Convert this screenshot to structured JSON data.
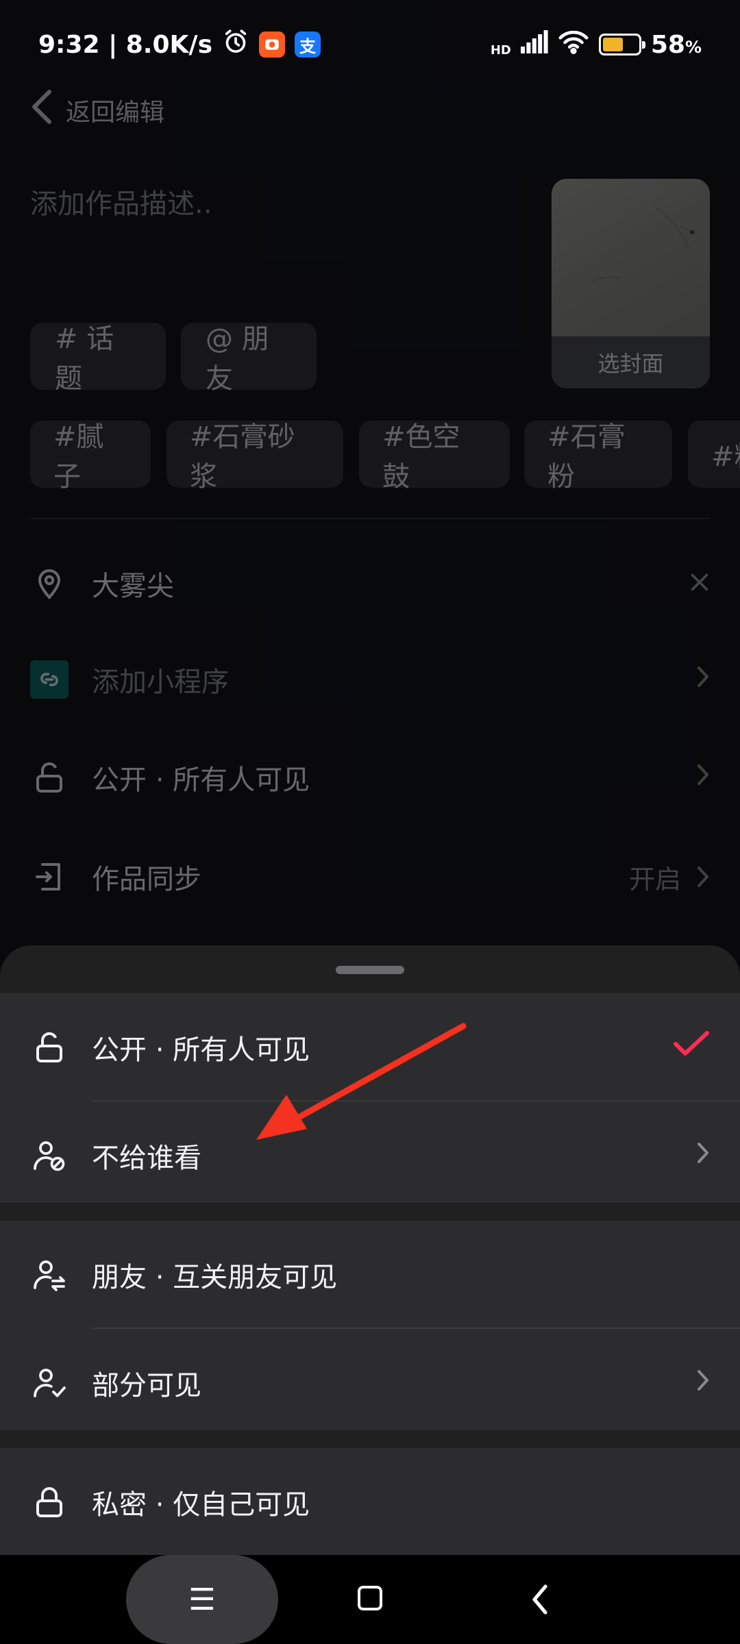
{
  "status_bar": {
    "time_speed": "9:32 | 8.0K/s",
    "network": "HD",
    "battery_percent": "58",
    "battery_unit": "%",
    "battery_level": 0.58,
    "apps": [
      {
        "name": "taobao-app-icon",
        "color": "#ff5a1f"
      },
      {
        "name": "alipay-app-icon",
        "label": "支",
        "color": "#1677ff"
      }
    ]
  },
  "header": {
    "back_label": "返回编辑"
  },
  "editor": {
    "description_placeholder": "添加作品描述..",
    "cover_label": "选封面",
    "topic_chip": "# 话题",
    "friend_chip": "@ 朋友",
    "hashtags": [
      "#腻子",
      "#石膏砂浆",
      "#色空鼓",
      "#石膏粉",
      "#粉"
    ]
  },
  "settings": {
    "location": "大雾尖",
    "mini_program": "添加小程序",
    "visibility": "公开 · 所有人可见",
    "sync_label": "作品同步",
    "sync_value": "开启"
  },
  "sheet": {
    "options": [
      {
        "label": "公开 · 所有人可见",
        "selected": true
      },
      {
        "label": "不给谁看",
        "selected": false
      },
      {
        "label": "朋友 · 互关朋友可见",
        "selected": false
      },
      {
        "label": "部分可见",
        "selected": false
      },
      {
        "label": "私密 · 仅自己可见",
        "selected": false
      }
    ],
    "accent_color": "#fe2c55"
  },
  "annotation": {
    "arrow_color": "#f5311f"
  },
  "nav": {
    "menu_glyph": "☰"
  }
}
